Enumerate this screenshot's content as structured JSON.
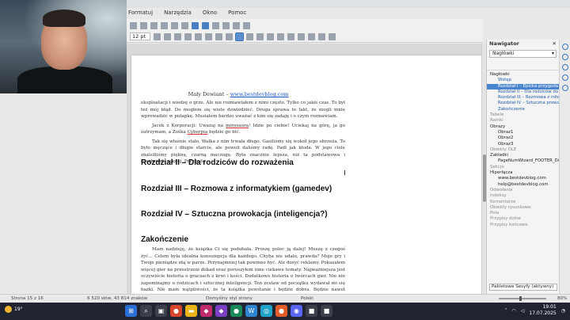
{
  "menu": [
    "Formatuj",
    "Narzędzia",
    "Okno",
    "Pomoc"
  ],
  "toolbar": {
    "font_size": "12 pt"
  },
  "page": {
    "header_prefix": "Mały Dewiant –",
    "header_link": "www.bestdevblog.com",
    "para1": "eksploatacji i wiedzę o grze. Ale nie rozmawiałem z nimi często. Tylko co jakiś czas. To był też mój błąd. Do mogłem się wiele dowiedzieć. Druga sprawa to fakt, że mogli mnie wprowadzić w pułapkę. Musiałem bardzo uważać z kim się zadaję i o czym rozmawiam.",
    "para2_a": "Jacek z Korporacji: Uważaj na ",
    "para2_u": "mirosaura",
    "para2_b": "! Idzie po ciebie! Uciekaj na górę, ja go zatrzymam, a Zośka ",
    "para2_u2": "Cyberpia",
    "para2_c": " będzie go bić.",
    "para3": "Tak się właśnie stało. Walka z nim trwała długo. Gasiliśmy się wokół jego obrzeża. To było męczące i długie starcie, ale powoli daliśmy radę. Padł jak kłoda. W jego ciele znaleźliśmy pięknę, czarną maczugę. Była znacznie lepsza, niż ta podstawowa i kosztowała więcej. Przygoda",
    "heading2": "Rozdział II – Dla rodziców do rozważenia",
    "heading3_a": "Rozdział III – Rozmowa z informatykiem (",
    "heading3_u": "gamedev",
    "heading3_b": ")",
    "heading4": "Rozdział IV – Sztuczna prowokacja (inteligencja?)",
    "heading5": "Zakończenie",
    "para_end": "Mam nadzieję, że książka Ci się podobała. Proszę polec ją dalej! Muszę z czegoś żyć… Celem była ideałna konsumpcja dla każdego. Chyba nie udało, prawda? Moje gry i Twoje pieniądze idą w parze. Przynajmniej tak powinno być. Ale dosyć reklamy. Pokazałem więcej gier na przestrzeni dekad oraz poruszyłem inne ciekawe tematy. Najważniejsza jest oczywiście historia o graczach z krwi i kości. Dodatkowo historia o twórcach gier. Nie nie zapominajmy o rodzicach i sztucznej inteligencji. Ten zestaw od początku wydawał mi się bazki. Nie mam wątpliwości, że ta książka powstanie i będzie dobra. Będzie nawet bardziej, niż dobra. Napisałem to na początku, bo"
  },
  "navigator": {
    "title": "Nawigator",
    "select_value": "Nagłówki",
    "items": [
      {
        "label": "Nagłówki",
        "level": 0,
        "state": "normal"
      },
      {
        "label": "Wstęp",
        "level": 1,
        "state": "blue"
      },
      {
        "label": "Rozdział I – Epicka przygoda",
        "level": 1,
        "state": "selected"
      },
      {
        "label": "Rozdział II – Dla rodziców do",
        "level": 1,
        "state": "blue"
      },
      {
        "label": "Rozdział III – Rozmowa z info",
        "level": 1,
        "state": "blue"
      },
      {
        "label": "Rozdział IV – Sztuczna prowo",
        "level": 1,
        "state": "blue"
      },
      {
        "label": "Zakończenie",
        "level": 1,
        "state": "blue"
      },
      {
        "label": "Tabele",
        "level": 0,
        "state": "grey"
      },
      {
        "label": "Ramki",
        "level": 0,
        "state": "grey"
      },
      {
        "label": "Obrazy",
        "level": 0,
        "state": "normal"
      },
      {
        "label": "Obraz1",
        "level": 1,
        "state": "normal"
      },
      {
        "label": "Obraz2",
        "level": 1,
        "state": "normal"
      },
      {
        "label": "Obraz3",
        "level": 1,
        "state": "normal"
      },
      {
        "label": "Obiekty OLE",
        "level": 0,
        "state": "grey"
      },
      {
        "label": "Zakładki",
        "level": 0,
        "state": "normal"
      },
      {
        "label": "PageNumWizard_FOOTER_Do",
        "level": 1,
        "state": "normal"
      },
      {
        "label": "Sekcje",
        "level": 0,
        "state": "grey"
      },
      {
        "label": "Hiperłącza",
        "level": 0,
        "state": "normal"
      },
      {
        "label": "www.bestdevblog.com",
        "level": 1,
        "state": "normal"
      },
      {
        "label": "help@bestdevblog.com",
        "level": 1,
        "state": "normal"
      },
      {
        "label": "Odwołania",
        "level": 0,
        "state": "grey"
      },
      {
        "label": "Indeksy",
        "level": 0,
        "state": "grey"
      },
      {
        "label": "Komentarze",
        "level": 0,
        "state": "grey"
      },
      {
        "label": "Obiekty rysunkowe",
        "level": 0,
        "state": "grey"
      },
      {
        "label": "Pola",
        "level": 0,
        "state": "grey"
      },
      {
        "label": "Przypisy dolne",
        "level": 0,
        "state": "grey"
      },
      {
        "label": "Przypisy końcowe",
        "level": 0,
        "state": "grey"
      }
    ],
    "bottom_select": "Pakietowe Sesyfy (aktywny)"
  },
  "status": {
    "page": "Strona 15 z 16",
    "words": "6 520 słów, 43 814 znaków",
    "style": "Domyślny styl strony",
    "language": "Polski",
    "zoom": "80%"
  },
  "taskbar": {
    "temp": "19°",
    "time": "19:01",
    "date": "17.07.2025"
  }
}
